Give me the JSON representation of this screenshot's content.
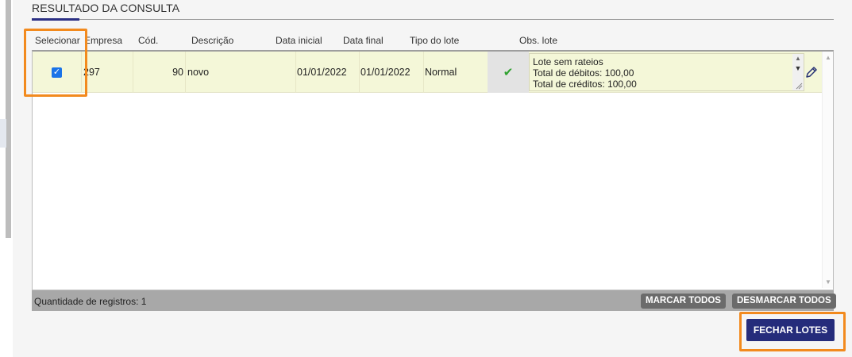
{
  "section": {
    "title": "RESULTADO DA CONSULTA"
  },
  "columns": {
    "selecionar": "Selecionar",
    "empresa": "Empresa",
    "cod": "Cód.",
    "descricao": "Descrição",
    "data_inicial": "Data inicial",
    "data_final": "Data final",
    "tipo_lote": "Tipo do lote",
    "obs_lote": "Obs. lote"
  },
  "rows": [
    {
      "selected": true,
      "empresa": "297",
      "cod": "90",
      "descricao": "novo",
      "data_inicial": "01/01/2022",
      "data_final": "01/01/2022",
      "tipo_lote": "Normal",
      "status_icon": "checkmark-icon",
      "obs_lines": [
        "Lote sem rateios",
        "Total de débitos: 100,00",
        "Total de créditos: 100,00"
      ]
    }
  ],
  "footer": {
    "count_label": "Quantidade de registros:",
    "count_value": "1",
    "mark_all": "MARCAR TODOS",
    "unmark_all": "DESMARCAR TODOS"
  },
  "actions": {
    "close_batches": "FECHAR LOTES"
  },
  "colors": {
    "primary": "#252c7b",
    "highlight": "#f28a1e",
    "row_bg": "#f4f7d8",
    "check": "#2ea12e"
  }
}
